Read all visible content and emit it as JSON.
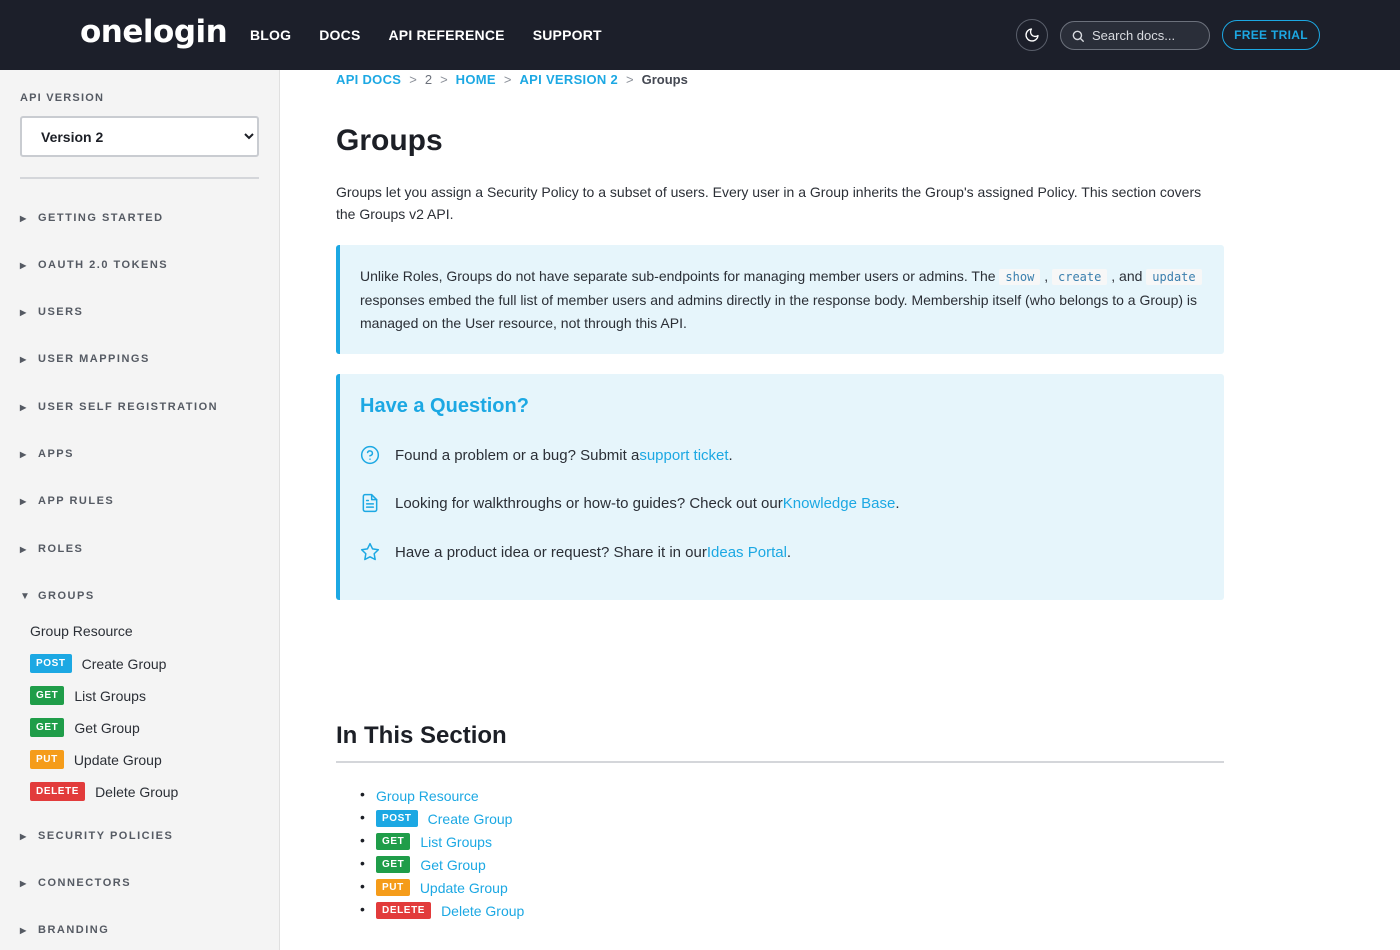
{
  "header": {
    "logo": "onelogin",
    "nav": [
      "BLOG",
      "DOCS",
      "API REFERENCE",
      "SUPPORT"
    ],
    "search_placeholder": "Search docs...",
    "trial_label": "FREE TRIAL",
    "icons": {
      "theme": "moon-icon",
      "search": "search-icon"
    }
  },
  "sidebar": {
    "label": "API VERSION",
    "version_selected": "Version 2",
    "sections": [
      "GETTING STARTED",
      "OAUTH 2.0 TOKENS",
      "USERS",
      "USER MAPPINGS",
      "USER SELF REGISTRATION",
      "APPS",
      "APP RULES",
      "ROLES",
      "GROUPS",
      "SECURITY POLICIES",
      "CONNECTORS",
      "BRANDING"
    ],
    "groups_items": [
      {
        "method": "",
        "label": "Group Resource"
      },
      {
        "method": "POST",
        "label": "Create Group"
      },
      {
        "method": "GET",
        "label": "List Groups"
      },
      {
        "method": "GET",
        "label": "Get Group"
      },
      {
        "method": "PUT",
        "label": "Update Group"
      },
      {
        "method": "DELETE",
        "label": "Delete Group"
      }
    ]
  },
  "breadcrumb": {
    "items": [
      "API DOCS",
      "2",
      "HOME",
      "API VERSION 2",
      "Groups"
    ],
    "separator": ">"
  },
  "main": {
    "title": "Groups",
    "intro": "Groups let you assign a Security Policy to a subset of users. Every user in a Group inherits the Group's assigned Policy. This section covers the Groups v2 API.",
    "note": {
      "part1": "Unlike Roles, Groups do not have separate sub-endpoints for managing member users or admins. The ",
      "code1": "show",
      "sep1": " , ",
      "code2": "create",
      "sep2": " , and ",
      "code3": "update",
      "part2": " responses embed the full list of member users and admins directly in the response body. Membership itself (who belongs to a Group) is managed on the User resource, not through this API."
    },
    "question": {
      "title": "Have a Question?",
      "rows": [
        {
          "icon": "help-circle-icon",
          "text": "Found a problem or a bug? Submit a ",
          "link": "support ticket",
          "end": "."
        },
        {
          "icon": "document-icon",
          "text": "Looking for walkthroughs or how-to guides? Check out our ",
          "link": "Knowledge Base",
          "end": "."
        },
        {
          "icon": "star-icon",
          "text": "Have a product idea or request? Share it in our ",
          "link": "Ideas Portal",
          "end": "."
        }
      ]
    },
    "section_title": "In This Section",
    "section_items": [
      {
        "method": "",
        "label": "Group Resource"
      },
      {
        "method": "POST",
        "label": "Create Group"
      },
      {
        "method": "GET",
        "label": "List Groups"
      },
      {
        "method": "GET",
        "label": "Get Group"
      },
      {
        "method": "PUT",
        "label": "Update Group"
      },
      {
        "method": "DELETE",
        "label": "Delete Group"
      }
    ]
  },
  "colors": {
    "accent": "#1ca8e3",
    "header_bg": "#1c1f2a",
    "post": "#1ca8e3",
    "get": "#1f9d49",
    "put": "#f59c1a",
    "delete": "#e23b3b"
  }
}
